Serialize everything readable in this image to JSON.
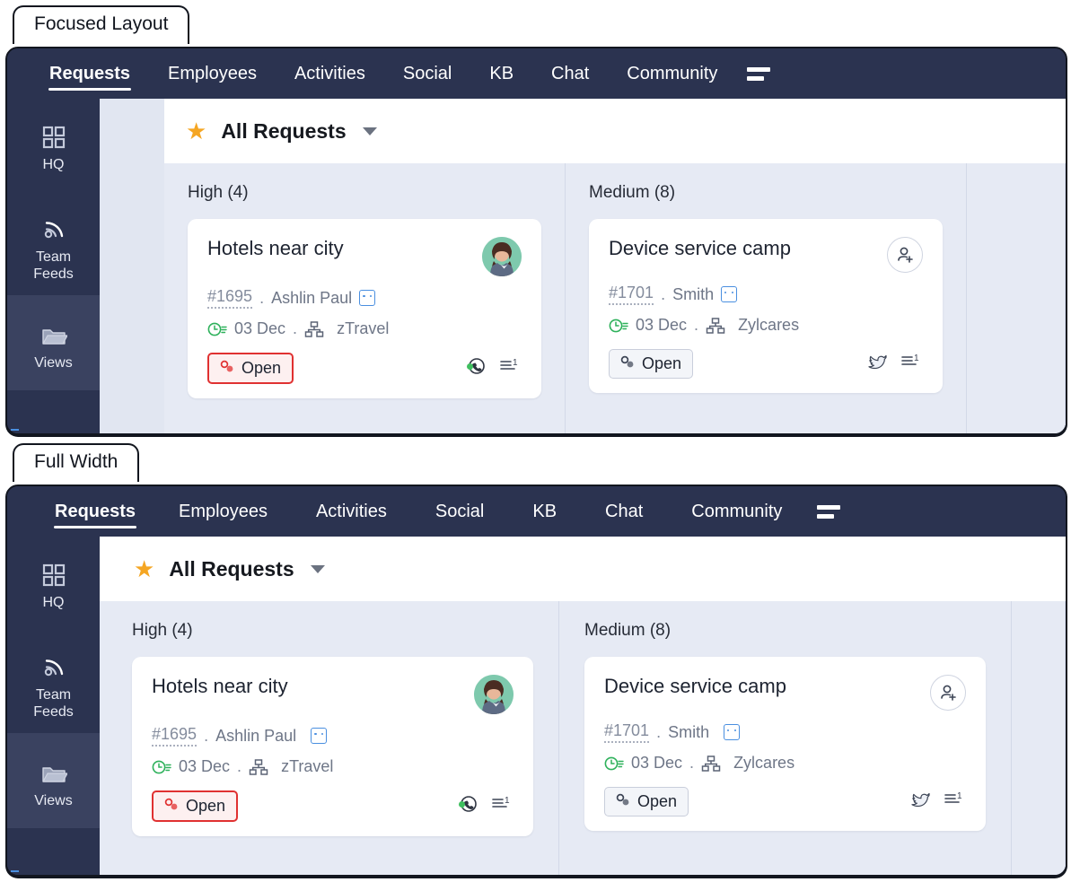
{
  "sections": [
    {
      "id": "focused",
      "label": "Focused Layout",
      "has_gutter": true
    },
    {
      "id": "fullwidth",
      "label": "Full Width",
      "has_gutter": false
    }
  ],
  "nav": {
    "items": [
      {
        "label": "Requests",
        "active": true
      },
      {
        "label": "Employees",
        "active": false
      },
      {
        "label": "Activities",
        "active": false
      },
      {
        "label": "Social",
        "active": false
      },
      {
        "label": "KB",
        "active": false
      },
      {
        "label": "Chat",
        "active": false
      },
      {
        "label": "Community",
        "active": false
      }
    ],
    "menu_icon": "hamburger-icon"
  },
  "sidebar": {
    "items": [
      {
        "label": "HQ",
        "icon": "grid-icon",
        "active": false
      },
      {
        "label": "Team Feeds",
        "label_line1": "Team",
        "label_line2": "Feeds",
        "icon": "rss-feed-icon",
        "active": false
      },
      {
        "label": "Views",
        "icon": "folder-icon",
        "active": true
      }
    ]
  },
  "viewbar": {
    "star_icon": "star-icon",
    "title": "All Requests",
    "caret_icon": "chevron-down-icon"
  },
  "board": {
    "columns": [
      {
        "title": "High (4)",
        "cards": [
          {
            "title": "Hotels near city",
            "ticket": "#1695",
            "separator": ".",
            "person": "Ashlin Paul",
            "person_icon": "contact-card-icon",
            "date": "03 Dec",
            "date_separator": ".",
            "org_icon": "org-chart-icon",
            "org": "zTravel",
            "status": "Open",
            "status_icon": "link-icon",
            "status_style": "red",
            "avatar": "user-photo-avatar",
            "footer_icons": [
              "whatsapp-icon",
              "notes-icon"
            ],
            "notes_count": "1"
          }
        ]
      },
      {
        "title": "Medium (8)",
        "cards": [
          {
            "title": "Device service camp",
            "ticket": "#1701",
            "separator": ".",
            "person": "Smith",
            "person_icon": "contact-card-icon",
            "date": "03 Dec",
            "date_separator": ".",
            "org_icon": "org-chart-icon",
            "org": "Zylcares",
            "status": "Open",
            "status_icon": "link-icon",
            "status_style": "gray",
            "avatar": "add-person-icon",
            "footer_icons": [
              "twitter-icon",
              "notes-icon"
            ],
            "notes_count": "1"
          }
        ]
      },
      {
        "title": "",
        "cards": []
      }
    ]
  },
  "colors": {
    "navy": "#2b3350",
    "rail_active": "#3a4260",
    "board_bg": "#e6eaf4",
    "gutter_bg": "#e1e6f1",
    "star": "#f5a623",
    "status_red": "#e03131",
    "clock_green": "#2eb15b",
    "avatar_bg": "#7ec9ad",
    "outline": "#12161f"
  }
}
